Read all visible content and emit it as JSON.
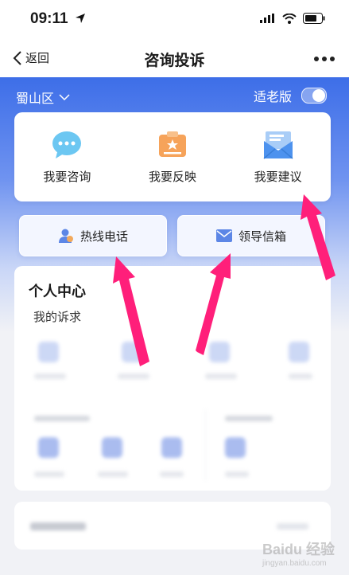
{
  "status": {
    "time": "09:11"
  },
  "nav": {
    "back_label": "返回",
    "title": "咨询投诉"
  },
  "header": {
    "region": "蜀山区",
    "elder_mode": "适老版"
  },
  "services": [
    {
      "label": "我要咨询",
      "icon": "chat-bubble-icon"
    },
    {
      "label": "我要反映",
      "icon": "id-card-icon"
    },
    {
      "label": "我要建议",
      "icon": "envelope-icon"
    }
  ],
  "contact": {
    "hotline": "热线电话",
    "mailbox": "领导信箱"
  },
  "personal": {
    "title": "个人中心",
    "subtitle": "我的诉求"
  },
  "colors": {
    "brand_blue": "#3d6ee8",
    "annotation_pink": "#ff1f7a"
  }
}
